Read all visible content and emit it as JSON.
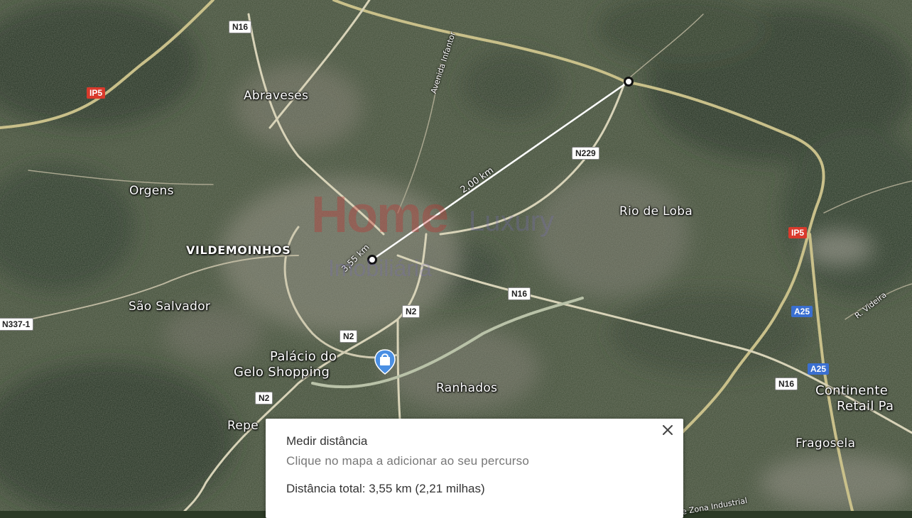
{
  "map": {
    "places": {
      "abraveses": "Abraveses",
      "orgens": "Orgens",
      "vildemoinhos": "VILDEMOINHOS",
      "sao_salvador": "São Salvador",
      "palacio_line1": "Palácio do",
      "palacio_line2": "Gelo Shopping",
      "ranhados": "Ranhados",
      "rio_de_loba": "Rio de Loba",
      "continente_line1": "Continente",
      "continente_line2": "Retail Pa",
      "fragosela": "Fragosela",
      "repe": "Repe",
      "avenida": "Avenida Infantor",
      "videira": "R. Videira",
      "zona_industrial": "e Zona Industrial"
    },
    "roads": {
      "n16_top": "N16",
      "ip5_left": "IP5",
      "n229": "N229",
      "ip5_right": "IP5",
      "n16_mid": "N16",
      "n2_a": "N2",
      "n2_b": "N2",
      "n2_c": "N2",
      "n337": "N337-1",
      "a25_a": "A25",
      "a25_b": "A25",
      "n16_right": "N16"
    },
    "measure": {
      "segment_label": "2,00 km",
      "start_label": "3,55 km"
    },
    "watermark": {
      "line1": "Home",
      "line2": "Luxury",
      "line3": "Imobiliária"
    },
    "icons": {
      "shop_pin": "shopping-bag-pin-icon"
    },
    "colors": {
      "shield_n": "#ffffff",
      "shield_ip": "#d93a2c",
      "shield_a": "#3a6fd0",
      "pin_blue": "#4a8fe3"
    }
  },
  "panel": {
    "title": "Medir distância",
    "hint": "Clique no mapa a adicionar ao seu percurso",
    "total": "Distância total: 3,55 km (2,21 milhas)"
  }
}
